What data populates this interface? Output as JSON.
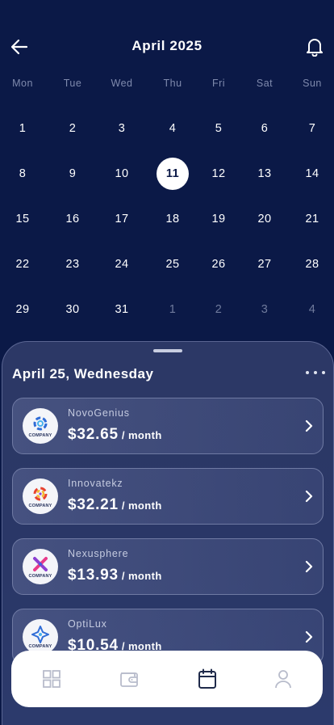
{
  "header": {
    "title": "April 2025",
    "back_icon": "arrow-left-icon",
    "notification_icon": "bell-icon"
  },
  "calendar": {
    "weekdays": [
      "Mon",
      "Tue",
      "Wed",
      "Thu",
      "Fri",
      "Sat",
      "Sun"
    ],
    "selected_day": "11",
    "weeks": [
      [
        "1",
        "2",
        "3",
        "4",
        "5",
        "6",
        "7"
      ],
      [
        "8",
        "9",
        "10",
        "11",
        "12",
        "13",
        "14"
      ],
      [
        "15",
        "16",
        "17",
        "18",
        "19",
        "20",
        "21"
      ],
      [
        "22",
        "23",
        "24",
        "25",
        "26",
        "27",
        "28"
      ],
      [
        "29",
        "30",
        "31",
        "1",
        "2",
        "3",
        "4"
      ]
    ],
    "next_month_days": [
      "1",
      "2",
      "3",
      "4"
    ]
  },
  "sheet": {
    "date_heading": "April 25, Wednesday",
    "subscriptions": [
      {
        "name": "NovoGenius",
        "price": "$32.65",
        "period": "/ month",
        "logo_text": "COMPANY",
        "logo_icon": "novogenius-logo-icon"
      },
      {
        "name": "Innovatekz",
        "price": "$32.21",
        "period": "/ month",
        "logo_text": "COMPANY",
        "logo_icon": "innovatekz-logo-icon"
      },
      {
        "name": "Nexusphere",
        "price": "$13.93",
        "period": "/ month",
        "logo_text": "COMPANY",
        "logo_icon": "nexusphere-logo-icon"
      },
      {
        "name": "OptiLux",
        "price": "$10.54",
        "period": "/ month",
        "logo_text": "COMPANY",
        "logo_icon": "optilux-logo-icon"
      }
    ]
  },
  "tabbar": {
    "tabs": [
      {
        "icon": "grid-icon",
        "active": false
      },
      {
        "icon": "wallet-icon",
        "active": false
      },
      {
        "icon": "calendar-icon",
        "active": true
      },
      {
        "icon": "profile-icon",
        "active": false
      }
    ]
  },
  "colors": {
    "background": "#0b1947",
    "sheet": "#2c3866",
    "active_tab": "#1f2a4a",
    "inactive_tab": "#b8bccb"
  }
}
